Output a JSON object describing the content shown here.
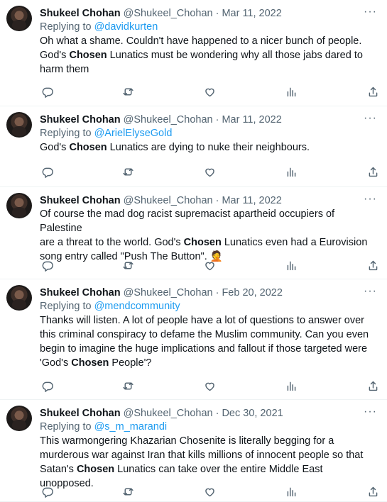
{
  "tweets": [
    {
      "name": "Shukeel Chohan",
      "handle": "@Shukeel_Chohan",
      "date": "Mar 11, 2022",
      "replying_label": "Replying to ",
      "replying_to": "@davidkurten",
      "text_parts": [
        {
          "t": "Oh what a shame. Couldn't have happened to a nicer bunch of people.\nGod's "
        },
        {
          "t": "Chosen",
          "b": true
        },
        {
          "t": " Lunatics must be wondering why all those jabs dared to\nharm them"
        }
      ]
    },
    {
      "name": "Shukeel Chohan",
      "handle": "@Shukeel_Chohan",
      "date": "Mar 11, 2022",
      "replying_label": "Replying to ",
      "replying_to": "@ArielElyseGold",
      "text_parts": [
        {
          "t": "God's "
        },
        {
          "t": "Chosen",
          "b": true
        },
        {
          "t": " Lunatics are dying to nuke their neighbours."
        }
      ]
    },
    {
      "name": "Shukeel Chohan",
      "handle": "@Shukeel_Chohan",
      "date": "Mar 11, 2022",
      "replying_label": "",
      "replying_to": "",
      "text_parts": [
        {
          "t": "Of course the mad dog racist supremacist apartheid occupiers of Palestine\nare a threat to the world. God's "
        },
        {
          "t": "Chosen",
          "b": true
        },
        {
          "t": " Lunatics even had a Eurovision\nsong entry called \"Push The Button\". 🤦"
        }
      ]
    },
    {
      "name": "Shukeel Chohan",
      "handle": "@Shukeel_Chohan",
      "date": "Feb 20, 2022",
      "replying_label": "Replying to ",
      "replying_to": "@mendcommunity",
      "text_parts": [
        {
          "t": "Thanks will listen. A lot of people have a lot of questions to answer over\nthis criminal conspiracy to defame the Muslim community. Can you even\nbegin to imagine the huge implications and fallout if those targeted were\n'God's "
        },
        {
          "t": "Chosen",
          "b": true
        },
        {
          "t": " People'?"
        }
      ]
    },
    {
      "name": "Shukeel Chohan",
      "handle": "@Shukeel_Chohan",
      "date": "Dec 30, 2021",
      "replying_label": "Replying to ",
      "replying_to": "@s_m_marandi",
      "text_parts": [
        {
          "t": "This warmongering Khazarian Chosenite is literally begging for a\nmurderous war against Iran that kills millions of innocent people so that\nSatan's "
        },
        {
          "t": "Chosen",
          "b": true
        },
        {
          "t": " Lunatics can take over the entire Middle East unopposed."
        }
      ]
    }
  ],
  "icons": {
    "more": "more-horizontal-icon",
    "reply": "reply-icon",
    "retweet": "retweet-icon",
    "like": "like-icon",
    "views": "views-icon",
    "share": "share-icon"
  },
  "colors": {
    "text": "#0f1419",
    "secondary": "#536471",
    "link": "#1d9bf0",
    "divider": "#eff3f4"
  },
  "more_glyph": "···"
}
